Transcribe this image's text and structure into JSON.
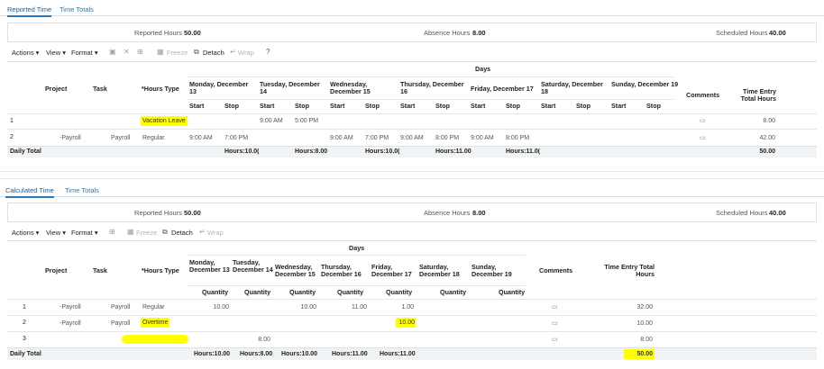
{
  "top": {
    "tabs": [
      {
        "label": "Reported Time"
      },
      {
        "label": "Time Totals"
      }
    ],
    "summary": {
      "reported_label": "Reported Hours",
      "reported_val": "50.00",
      "absence_label": "Absence Hours",
      "absence_val": "8.00",
      "scheduled_label": "Scheduled Hours",
      "scheduled_val": "40.00"
    },
    "toolbar": {
      "actions": "Actions ▾",
      "view": "View ▾",
      "format": "Format ▾",
      "freeze": "Freeze",
      "detach": "Detach",
      "wrap": "Wrap"
    },
    "headers": {
      "days": "Days",
      "project": "Project",
      "task": "Task",
      "hours_type": "*Hours Type",
      "comments": "Comments",
      "total": "Time Entry Total Hours",
      "start": "Start",
      "stop": "Stop"
    },
    "day_headers": [
      "Monday, December 13",
      "Tuesday, December 14",
      "Wednesday, December 15",
      "Thursday, December 16",
      "Friday, December 17",
      "Saturday, December 18",
      "Sunday, December 19"
    ],
    "rows": [
      {
        "num": "1",
        "project": "",
        "task": "",
        "hours_type": "Vacation Leave",
        "times": [
          "",
          "",
          "9:00 AM",
          "5:00 PM",
          "",
          "",
          "",
          "",
          "",
          "",
          "",
          ""
        ],
        "total": "8.00"
      },
      {
        "num": "2",
        "project": "-Payroll",
        "task": "Payroll",
        "hours_type": "Regular",
        "times": [
          "9:00 AM",
          "7:00 PM",
          "",
          "",
          "9:00 AM",
          "7:00 PM",
          "9:00 AM",
          "8:00 PM",
          "9:00 AM",
          "8:00 PM",
          "",
          ""
        ],
        "total": "42.00"
      }
    ],
    "daily_total": {
      "label": "Daily Total",
      "values": [
        "Hours:10.0(",
        "Hours:8.00",
        "Hours:10.0(",
        "Hours:11.00",
        "Hours:11.0("
      ],
      "total": "50.00"
    }
  },
  "bottom": {
    "tabs": [
      {
        "label": "Calculated Time"
      },
      {
        "label": "Time Totals"
      }
    ],
    "summary": {
      "reported_label": "Reported Hours",
      "reported_val": "50.00",
      "absence_label": "Absence Hours",
      "absence_val": "8.00",
      "scheduled_label": "Scheduled Hours",
      "scheduled_val": "40.00"
    },
    "toolbar": {
      "actions": "Actions ▾",
      "view": "View ▾",
      "format": "Format ▾",
      "freeze": "Freeze",
      "detach": "Detach",
      "wrap": "Wrap"
    },
    "headers": {
      "days": "Days",
      "project": "Project",
      "task": "Task",
      "hours_type": "*Hours Type",
      "comments": "Comments",
      "total": "Time Entry Total Hours",
      "quantity": "Quantity"
    },
    "day_headers": [
      "Monday, December 13",
      "Tuesday, December 14",
      "Wednesday, December 15",
      "Thursday, December 16",
      "Friday, December 17",
      "Saturday, December 18",
      "Sunday, December 19"
    ],
    "rows": [
      {
        "num": "1",
        "project": "-Payroll",
        "task": "Payroll",
        "hours_type": "Regular",
        "q": [
          "10.00",
          "",
          "10.00",
          "11.00",
          "1.00",
          "",
          ""
        ],
        "total": "32.00"
      },
      {
        "num": "2",
        "project": "-Payroll",
        "task": "Payroll",
        "hours_type": "Overtime",
        "q": [
          "",
          "",
          "",
          "",
          "10.00",
          "",
          ""
        ],
        "total": "10.00"
      },
      {
        "num": "3",
        "project": "",
        "task": "",
        "hours_type": "",
        "q": [
          "",
          "8.00",
          "",
          "",
          "",
          "",
          ""
        ],
        "total": "8.00"
      }
    ],
    "daily_total": {
      "label": "Daily Total",
      "values": [
        "Hours:10.00",
        "Hours:8.00",
        "Hours:10.00",
        "Hours:11.00",
        "Hours:11.00"
      ],
      "total": "50.00"
    }
  },
  "colors": {
    "accent": "#2a78b8",
    "highlight": "#ffff00"
  }
}
